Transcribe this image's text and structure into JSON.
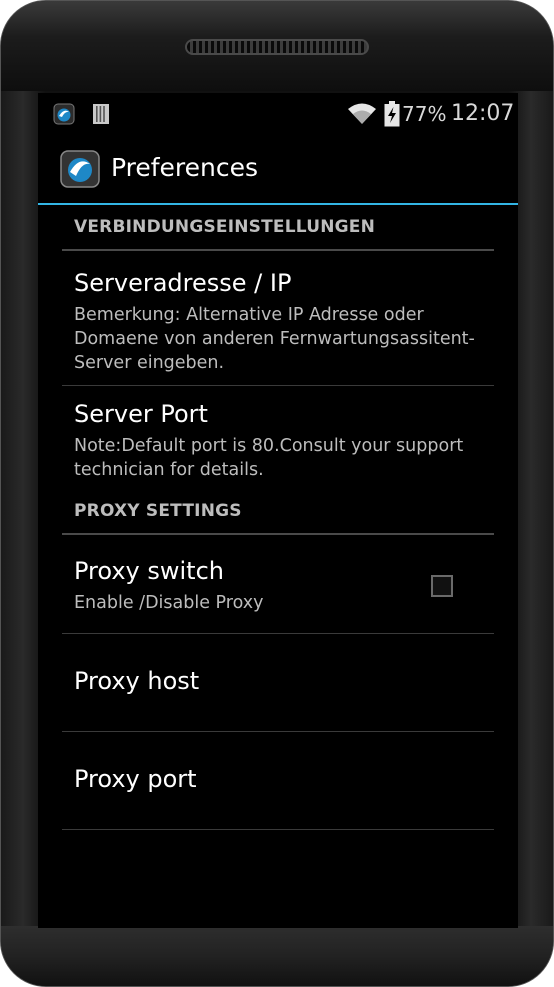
{
  "status_bar": {
    "battery_percent": "77%",
    "time": "12:07"
  },
  "action_bar": {
    "title": "Preferences"
  },
  "sections": [
    {
      "header": "VERBINDUNGSEINSTELLUNGEN",
      "items": [
        {
          "title": "Serveradresse / IP",
          "summary": "Bemerkung: Alternative IP Adresse oder Domaene von anderen Fernwartungsassitent-Server eingeben."
        },
        {
          "title": "Server Port",
          "summary": "Note:Default port is 80.Consult your support technician for details."
        }
      ]
    },
    {
      "header": "PROXY SETTINGS",
      "items": [
        {
          "title": "Proxy switch",
          "summary": "Enable /Disable Proxy",
          "checked": false
        },
        {
          "title": "Proxy host"
        },
        {
          "title": "Proxy port"
        }
      ]
    }
  ],
  "colors": {
    "accent": "#33b5e5",
    "background": "#000000",
    "text_primary": "#ffffff",
    "text_secondary": "#bdbdbd"
  },
  "icons": {
    "app": "app-logo-icon",
    "sd_card": "sd-card-icon",
    "wifi": "wifi-icon",
    "battery": "battery-charging-icon"
  }
}
